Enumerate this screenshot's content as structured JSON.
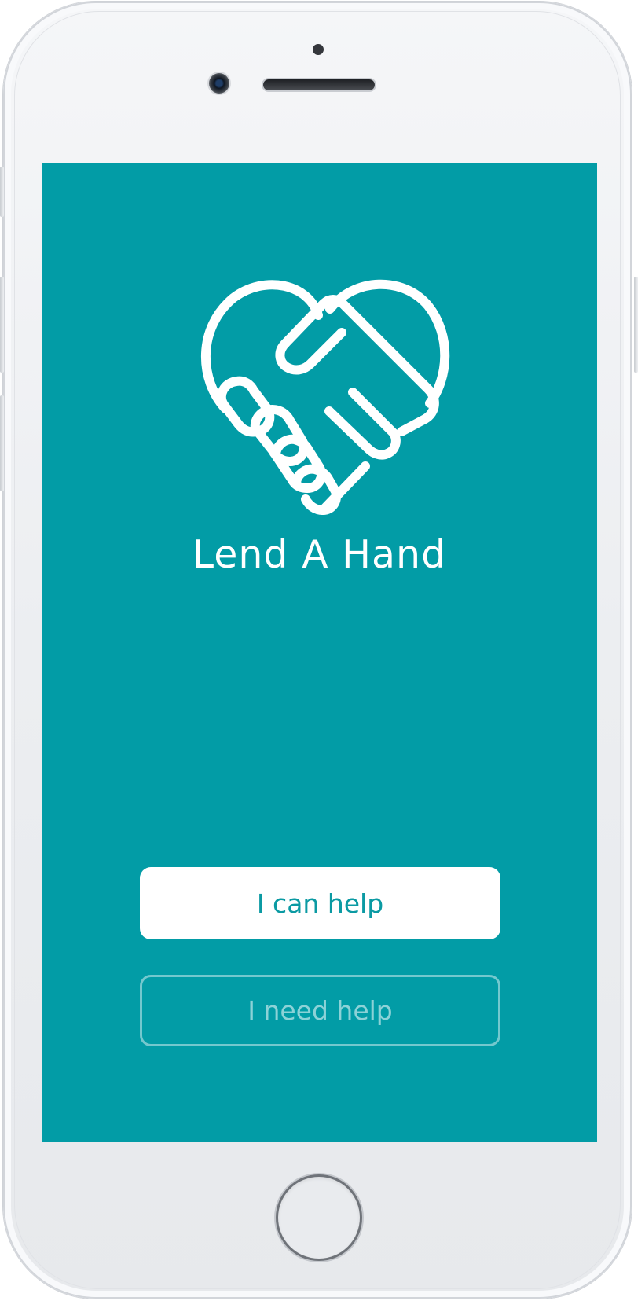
{
  "app": {
    "title": "Lend A Hand",
    "logo_icon": "heart-handshake-icon"
  },
  "actions": {
    "offer_help_label": "I can help",
    "request_help_label": "I need help"
  },
  "colors": {
    "screen_background": "#029ca6",
    "primary_button_bg": "#ffffff",
    "primary_button_text": "#0b9aa3",
    "secondary_button_border": "rgba(255,255,255,0.45)",
    "text_light": "#ffffff"
  }
}
